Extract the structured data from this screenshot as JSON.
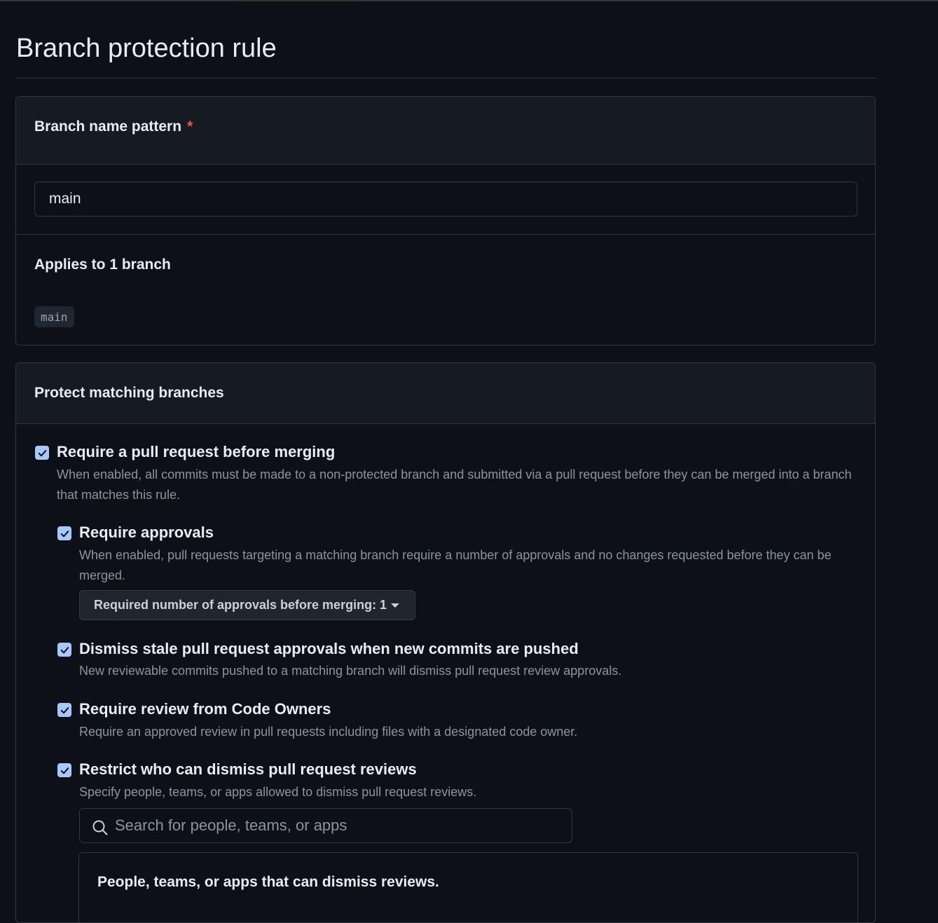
{
  "page": {
    "title": "Branch protection rule"
  },
  "branch_name": {
    "heading": "Branch name pattern",
    "required_marker": "*",
    "pattern_value": "main",
    "applies_heading": "Applies to 1 branch",
    "matching_branches": [
      "main"
    ]
  },
  "protect": {
    "heading": "Protect matching branches",
    "require_pr": {
      "checked": true,
      "label": "Require a pull request before merging",
      "description": "When enabled, all commits must be made to a non-protected branch and submitted via a pull request before they can be merged into a branch that matches this rule."
    },
    "require_approvals": {
      "checked": true,
      "label": "Require approvals",
      "description": "When enabled, pull requests targeting a matching branch require a number of approvals and no changes requested before they can be merged.",
      "select_label": "Required number of approvals before merging: 1"
    },
    "dismiss_stale": {
      "checked": true,
      "label": "Dismiss stale pull request approvals when new commits are pushed",
      "description": "New reviewable commits pushed to a matching branch will dismiss pull request review approvals."
    },
    "code_owners": {
      "checked": true,
      "label": "Require review from Code Owners",
      "description": "Require an approved review in pull requests including files with a designated code owner."
    },
    "restrict_dismiss": {
      "checked": true,
      "label": "Restrict who can dismiss pull request reviews",
      "description": "Specify people, teams, or apps allowed to dismiss pull request reviews.",
      "search_placeholder": "Search for people, teams, or apps",
      "list_heading": "People, teams, or apps that can dismiss reviews."
    }
  },
  "colors": {
    "background": "#0d1117",
    "panel_header": "#161b22",
    "border": "#30363d",
    "checkbox": "#a5c8ff",
    "required_star": "#f85149",
    "muted_text": "#8b949e"
  }
}
